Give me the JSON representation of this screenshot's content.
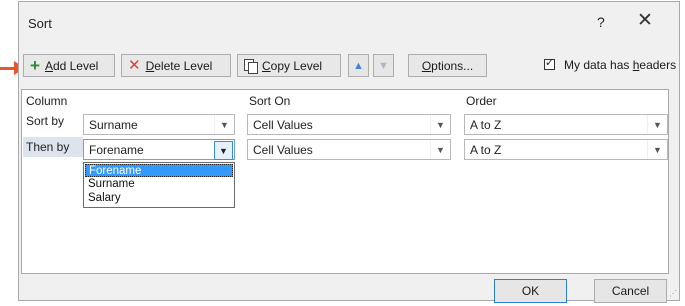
{
  "window": {
    "title": "Sort",
    "help_label": "?",
    "close_label": "✕"
  },
  "toolbar": {
    "add_level": {
      "pre": "",
      "u": "A",
      "post": "dd Level"
    },
    "delete_level": {
      "pre": "",
      "u": "D",
      "post": "elete Level"
    },
    "copy_level": {
      "pre": "",
      "u": "C",
      "post": "opy Level"
    },
    "move_up": "⌃",
    "move_down": "⌄",
    "options": {
      "pre": "",
      "u": "O",
      "post": "ptions..."
    },
    "my_data_headers": {
      "pre": "My data has ",
      "u": "h",
      "post": "eaders",
      "checked": true
    }
  },
  "grid": {
    "headers": {
      "column": "Column",
      "sort_on": "Sort On",
      "order": "Order"
    },
    "rows": [
      {
        "label": "Sort by",
        "column": "Surname",
        "sort_on": "Cell Values",
        "order": "A to Z"
      },
      {
        "label": "Then by",
        "column": "Forename",
        "sort_on": "Cell Values",
        "order": "A to Z"
      }
    ]
  },
  "dropdown_options": [
    "Forename",
    "Surname",
    "Salary"
  ],
  "dropdown_selected": "Forename",
  "footer": {
    "ok": "OK",
    "cancel": "Cancel"
  },
  "icons": {
    "add": "plus-icon",
    "delete": "x-icon",
    "copy": "copy-icon",
    "up": "chevron-up-icon",
    "down": "chevron-down-icon",
    "dropdown": "chevron-down-icon"
  },
  "colors": {
    "accent_blue": "#3399ff",
    "add_green": "#2e8b3a",
    "delete_red": "#d9443a",
    "pointer_arrow": "#e8542c"
  }
}
